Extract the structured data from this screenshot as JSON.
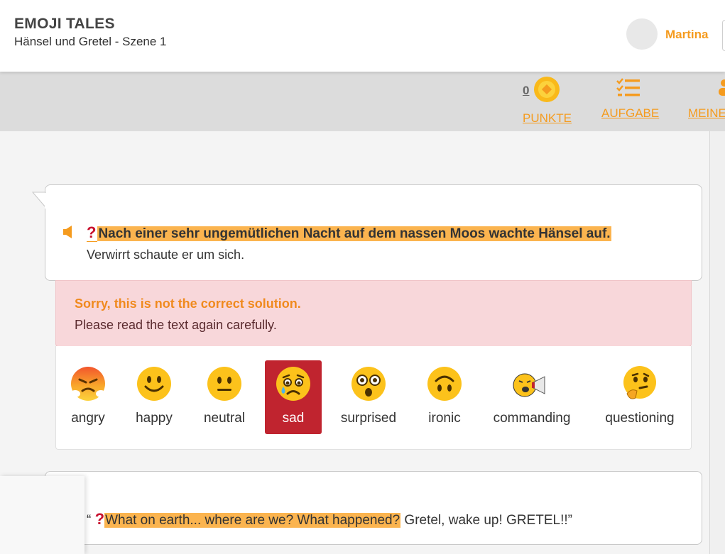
{
  "header": {
    "app_title": "EMOJI TALES",
    "subtitle": "Hänsel und Gretel - Szene 1",
    "username": "Martina"
  },
  "toolbar": {
    "points_value": "0",
    "points_label": "PUNKTE",
    "task_label": "AUFGABE",
    "mine_label": "MEINE"
  },
  "story": {
    "sentence1_highlight": "Nach einer sehr ungemütlichen Nacht auf dem nassen Moos wachte Hänsel auf.",
    "sentence1_rest": "Verwirrt schaute er um sich.",
    "question_mark": "?",
    "sentence2_open_quote": "“",
    "sentence2_highlight": "What on earth... where are we? What happened?",
    "sentence2_rest": " Gretel, wake up! GRETEL!!”"
  },
  "feedback": {
    "title": "Sorry, this is not the correct solution.",
    "message": "Please read the text again carefully."
  },
  "emotions": [
    {
      "label": "angry",
      "selected": false
    },
    {
      "label": "happy",
      "selected": false
    },
    {
      "label": "neutral",
      "selected": false
    },
    {
      "label": "sad",
      "selected": true
    },
    {
      "label": "surprised",
      "selected": false
    },
    {
      "label": "ironic",
      "selected": false
    },
    {
      "label": "commanding",
      "selected": false
    },
    {
      "label": "questioning",
      "selected": false
    }
  ],
  "colors": {
    "accent": "#f59b1e",
    "highlight": "#fbb44f",
    "selected": "#c0242f",
    "error_bg": "#f8d7da"
  },
  "icons": {
    "speaker": "speaker-icon",
    "coin": "coin-icon",
    "tasks": "checklist-icon",
    "mine": "person-icon"
  }
}
